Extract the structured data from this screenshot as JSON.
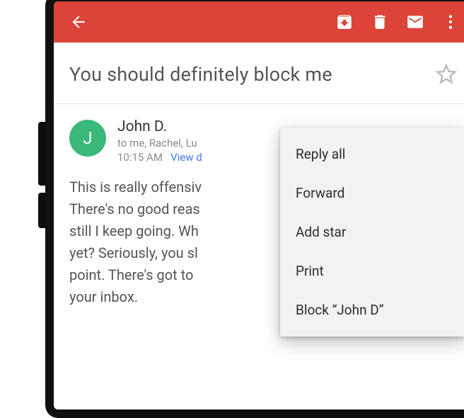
{
  "appbar": {
    "actions": {
      "back": "back-arrow",
      "archive": "archive",
      "delete": "delete",
      "mark_unread": "mark-unread",
      "overflow": "more"
    }
  },
  "email": {
    "subject": "You should definitely block me",
    "starred": false,
    "sender": {
      "name": "John D.",
      "initial": "J",
      "avatar_color": "#3ab97a"
    },
    "recipients_line": "to me, Rachel, Lu",
    "timestamp": "10:15 AM",
    "view_details_label": "View d",
    "body": "This is really offensiv\nThere's no good reas\nstill I keep going. Wh\nyet? Seriously, you sl\npoint. There's got to\nyour inbox."
  },
  "menu": {
    "items": [
      "Reply all",
      "Forward",
      "Add star",
      "Print",
      "Block “John D”"
    ]
  }
}
